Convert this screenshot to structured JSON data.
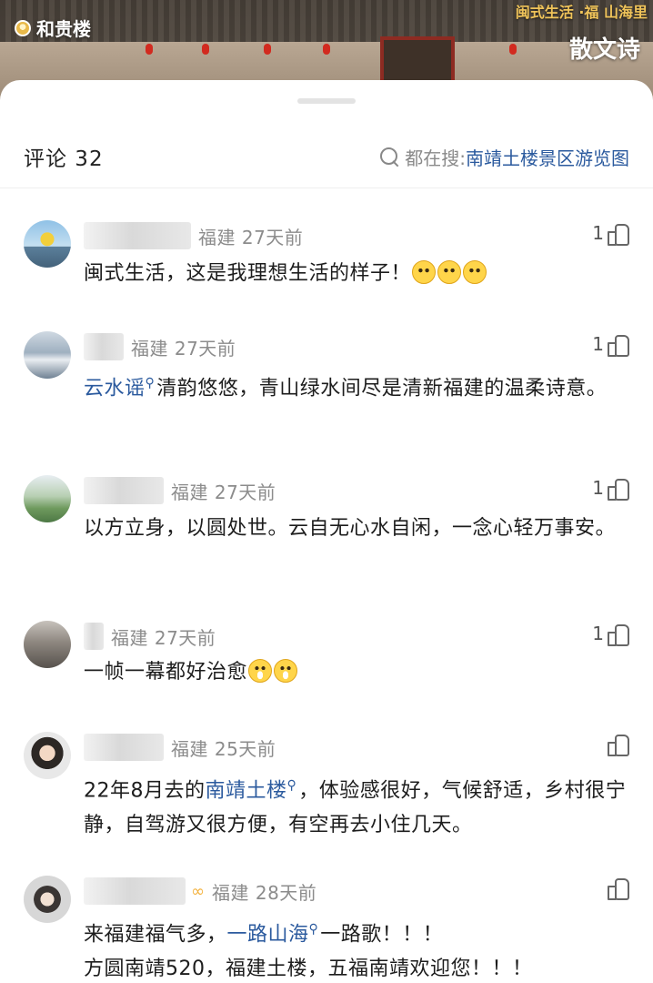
{
  "banner": {
    "title": "和贵楼",
    "slogan": "闽式生活 ·福 山海里",
    "poem": "散文诗"
  },
  "sheet": {
    "comment_label": "评论 32",
    "search_prefix": "都在搜:",
    "search_term": "南靖土楼景区游览图"
  },
  "comments": [
    {
      "meta": "福建 27天前",
      "likes": "1",
      "text": "闽式生活，这是我理想生活的样子！"
    },
    {
      "meta": "福建 27天前",
      "likes": "1",
      "tag": "云水谣",
      "text": "清韵悠悠，青山绿水间尽是清新福建的温柔诗意。"
    },
    {
      "meta": "福建 27天前",
      "likes": "1",
      "text": "以方立身，以圆处世。云自无心水自闲，一念心轻万事安。"
    },
    {
      "meta": "福建 27天前",
      "likes": "1",
      "text": "一帧一幕都好治愈"
    },
    {
      "meta": "福建 25天前",
      "likes": "",
      "text_before": "22年8月去的",
      "tag": "南靖土楼",
      "text_after": "，体验感很好，气候舒适，乡村很宁静，自驾游又很方便，有空再去小住几天。"
    },
    {
      "meta": "福建 28天前",
      "likes": "",
      "text_before": "来福建福气多，",
      "tag": "一路山海",
      "text_after": "一路歌！！！",
      "text_line2": "方圆南靖520，福建土楼，五福南靖欢迎您！！！"
    }
  ],
  "colors": {
    "link": "#2b5a9e",
    "meta": "#8c8c8c"
  }
}
